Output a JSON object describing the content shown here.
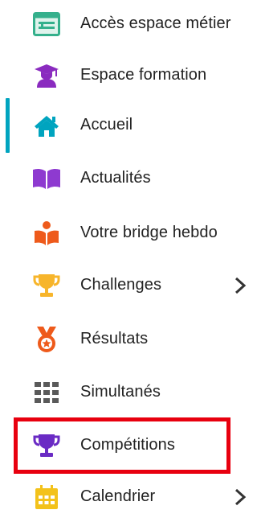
{
  "menu": {
    "items": [
      {
        "label": "Accès espace métier",
        "icon": "id-card-icon",
        "icon_color": "#35b08c",
        "has_submenu": false
      },
      {
        "label": "Espace formation",
        "icon": "graduate-icon",
        "icon_color": "#8a2bbf",
        "has_submenu": false
      },
      {
        "label": "Accueil",
        "icon": "home-icon",
        "icon_color": "#00a4bf",
        "has_submenu": false,
        "active": true
      },
      {
        "label": "Actualités",
        "icon": "open-book-icon",
        "icon_color": "#8e3ad0",
        "has_submenu": false
      },
      {
        "label": "Votre bridge hebdo",
        "icon": "reader-icon",
        "icon_color": "#ee5a1b",
        "has_submenu": false
      },
      {
        "label": "Challenges",
        "icon": "cup-icon",
        "icon_color": "#f7b52b",
        "has_submenu": true
      },
      {
        "label": "Résultats",
        "icon": "medal-icon",
        "icon_color": "#ee5a1b",
        "has_submenu": false
      },
      {
        "label": "Simultanés",
        "icon": "grid-icon",
        "icon_color": "#5a5a5a",
        "has_submenu": false
      },
      {
        "label": "Compétitions",
        "icon": "trophy-icon",
        "icon_color": "#6a2bc4",
        "has_submenu": false,
        "highlighted": true
      },
      {
        "label": "Calendrier",
        "icon": "calendar-icon",
        "icon_color": "#f3c21b",
        "has_submenu": true
      }
    ]
  },
  "colors": {
    "active_indicator": "#00a4bf",
    "highlight_border": "#e8000f",
    "text": "#222222",
    "chevron": "#333333"
  }
}
